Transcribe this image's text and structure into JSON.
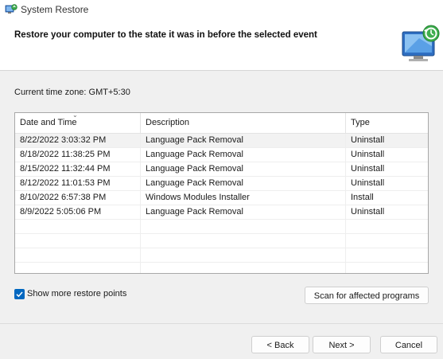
{
  "window": {
    "title": "System Restore",
    "icon": "system-restore-icon"
  },
  "header": {
    "title": "Restore your computer to the state it was in before the selected event",
    "graphic": "restore-computer-illustration"
  },
  "timezone": {
    "label": "Current time zone: GMT+5:30"
  },
  "restore_list": {
    "columns": [
      "Date and Time",
      "Description",
      "Type"
    ],
    "rows": [
      {
        "date": "8/22/2022 3:03:32 PM",
        "description": "Language Pack Removal",
        "type": "Uninstall",
        "selected": true
      },
      {
        "date": "8/18/2022 11:38:25 PM",
        "description": "Language Pack Removal",
        "type": "Uninstall",
        "selected": false
      },
      {
        "date": "8/15/2022 11:32:44 PM",
        "description": "Language Pack Removal",
        "type": "Uninstall",
        "selected": false
      },
      {
        "date": "8/12/2022 11:01:53 PM",
        "description": "Language Pack Removal",
        "type": "Uninstall",
        "selected": false
      },
      {
        "date": "8/10/2022 6:57:38 PM",
        "description": "Windows Modules Installer",
        "type": "Install",
        "selected": false
      },
      {
        "date": "8/9/2022 5:05:06 PM",
        "description": "Language Pack Removal",
        "type": "Uninstall",
        "selected": false
      }
    ]
  },
  "show_more": {
    "label": "Show more restore points",
    "checked": true
  },
  "buttons": {
    "scan": "Scan for affected programs",
    "back": "< Back",
    "next": "Next >",
    "cancel": "Cancel"
  },
  "colors": {
    "accent": "#0067c0"
  }
}
